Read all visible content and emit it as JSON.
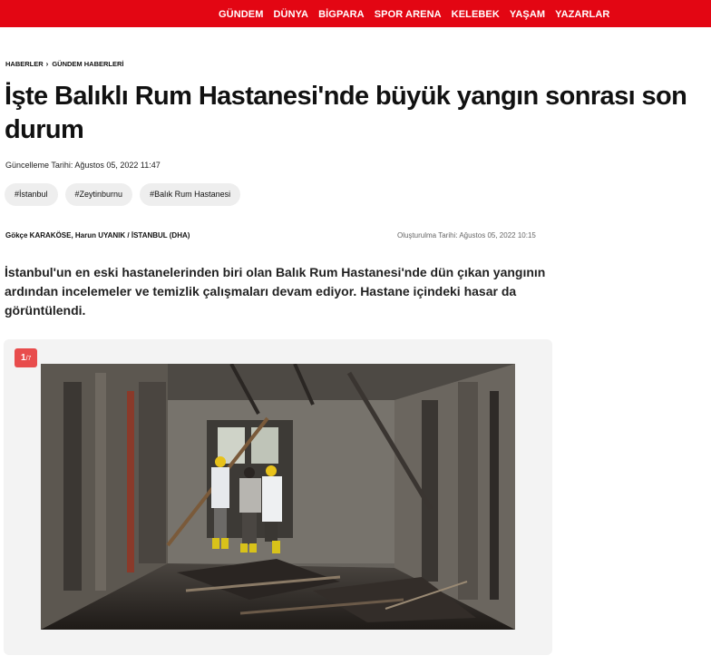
{
  "nav": {
    "items": [
      "GÜNDEM",
      "DÜNYA",
      "BİGPARA",
      "SPOR ARENA",
      "KELEBEK",
      "YAŞAM",
      "YAZARLAR"
    ]
  },
  "breadcrumb": {
    "home": "HABERLER",
    "separator": "›",
    "section": "GÜNDEM HABERLERİ"
  },
  "article": {
    "title_line1": "İşte Balıklı Rum Hastanesi'nde büyük yangın sonrası son",
    "title_line2": "durum",
    "updated": "Güncelleme Tarihi: Ağustos 05, 2022 11:47",
    "tags": [
      "#İstanbul",
      "#Zeytinburnu",
      "#Balık Rum Hastanesi"
    ],
    "byline": "Gökçe KARAKÖSE, Harun UYANIK / İSTANBUL (DHA)",
    "created": "Oluşturulma Tarihi: Ağustos 05, 2022 10:15",
    "summary": "İstanbul'un en eski hastanelerinden biri olan Balık Rum Hastanesi'nde dün çıkan yangının ardından incelemeler ve temizlik çalışmaları devam ediyor. Hastane içindeki hasar da görüntülendi."
  },
  "gallery": {
    "current": "1",
    "total": "/7",
    "photo_icon": "burned-hospital-corridor-photo"
  },
  "colors": {
    "brand": "#e30613",
    "counter": "#e84c4c",
    "tag_bg": "#eeeeee",
    "gallery_bg": "#f3f3f3"
  }
}
